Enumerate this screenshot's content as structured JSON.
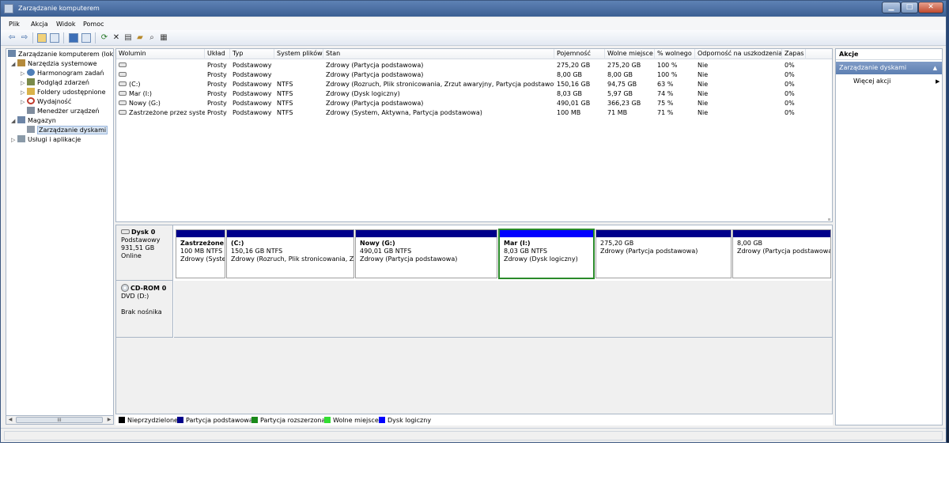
{
  "window": {
    "title": "Zarządzanie komputerem"
  },
  "menu": [
    "Plik",
    "Akcja",
    "Widok",
    "Pomoc"
  ],
  "tree": {
    "items": [
      {
        "label": "Zarządzanie komputerem (loka",
        "level": 0,
        "expander": "",
        "icon": "computer-icon",
        "color": "#6b86a8"
      },
      {
        "label": "Narzędzia systemowe",
        "level": 1,
        "expander": "◢",
        "icon": "tools-icon",
        "color": "#b48a3c"
      },
      {
        "label": "Harmonogram zadań",
        "level": 2,
        "expander": "▷",
        "icon": "clock-icon",
        "color": "#4f7fb8"
      },
      {
        "label": "Podgląd zdarzeń",
        "level": 2,
        "expander": "▷",
        "icon": "event-viewer-icon",
        "color": "#7a8a4a"
      },
      {
        "label": "Foldery udostępnione",
        "level": 2,
        "expander": "▷",
        "icon": "shared-folder-icon",
        "color": "#d9b24a"
      },
      {
        "label": "Wydajność",
        "level": 2,
        "expander": "▷",
        "icon": "performance-icon",
        "color": "#c0392b"
      },
      {
        "label": "Menedżer urządzeń",
        "level": 2,
        "expander": "",
        "icon": "device-manager-icon",
        "color": "#7f8c9d"
      },
      {
        "label": "Magazyn",
        "level": 1,
        "expander": "◢",
        "icon": "storage-icon",
        "color": "#6d85a6"
      },
      {
        "label": "Zarządzanie dyskami",
        "level": 2,
        "expander": "",
        "icon": "disk-management-icon",
        "color": "#8e99a6",
        "selected": true
      },
      {
        "label": "Usługi i aplikacje",
        "level": 1,
        "expander": "▷",
        "icon": "services-icon",
        "color": "#8a9aa8"
      }
    ],
    "scroll_glyph": "III"
  },
  "volumes": {
    "headers": [
      "Wolumin",
      "Układ",
      "Typ",
      "System plików",
      "Stan",
      "Pojemność",
      "Wolne miejsce",
      "% wolnego",
      "Odporność na uszkodzenia",
      "Zapas"
    ],
    "rows": [
      [
        "",
        "Prosty",
        "Podstawowy",
        "",
        "Zdrowy (Partycja podstawowa)",
        "275,20 GB",
        "275,20 GB",
        "100 %",
        "Nie",
        "0%"
      ],
      [
        "",
        "Prosty",
        "Podstawowy",
        "",
        "Zdrowy (Partycja podstawowa)",
        "8,00 GB",
        "8,00 GB",
        "100 %",
        "Nie",
        "0%"
      ],
      [
        "(C:)",
        "Prosty",
        "Podstawowy",
        "NTFS",
        "Zdrowy (Rozruch, Plik stronicowania, Zrzut awaryjny, Partycja podstawowa)",
        "150,16 GB",
        "94,75 GB",
        "63 %",
        "Nie",
        "0%"
      ],
      [
        "Mar (I:)",
        "Prosty",
        "Podstawowy",
        "NTFS",
        "Zdrowy (Dysk logiczny)",
        "8,03 GB",
        "5,97 GB",
        "74 %",
        "Nie",
        "0%"
      ],
      [
        "Nowy (G:)",
        "Prosty",
        "Podstawowy",
        "NTFS",
        "Zdrowy (Partycja podstawowa)",
        "490,01 GB",
        "366,23 GB",
        "75 %",
        "Nie",
        "0%"
      ],
      [
        "Zastrzeżone przez system",
        "Prosty",
        "Podstawowy",
        "NTFS",
        "Zdrowy (System, Aktywna, Partycja podstawowa)",
        "100 MB",
        "71 MB",
        "71 %",
        "Nie",
        "0%"
      ]
    ]
  },
  "disk0": {
    "name": "Dysk 0",
    "type": "Podstawowy",
    "size": "931,51 GB",
    "status": "Online",
    "partitions": [
      {
        "name": "Zastrzeżone p",
        "size": "100 MB NTFS",
        "status": "Zdrowy (Syste",
        "kind": "primary"
      },
      {
        "name": "(C:)",
        "size": "150,16 GB NTFS",
        "status": "Zdrowy (Rozruch, Plik stronicowania, Zrz",
        "kind": "primary"
      },
      {
        "name": "Nowy  (G:)",
        "size": "490,01 GB NTFS",
        "status": "Zdrowy (Partycja podstawowa)",
        "kind": "primary"
      },
      {
        "name": "Mar  (I:)",
        "size": "8,03 GB NTFS",
        "status": "Zdrowy (Dysk logiczny)",
        "kind": "logical",
        "selected": true
      },
      {
        "name": "",
        "size": "275,20 GB",
        "status": "Zdrowy (Partycja podstawowa)",
        "kind": "primary"
      },
      {
        "name": "",
        "size": "8,00 GB",
        "status": "Zdrowy (Partycja podstawowa)",
        "kind": "primary"
      }
    ]
  },
  "cdrom0": {
    "name": "CD-ROM 0",
    "drive": "DVD (D:)",
    "status": "Brak nośnika"
  },
  "legend": [
    {
      "label": "Nieprzydzielone",
      "color": "#000000"
    },
    {
      "label": "Partycja podstawowa",
      "color": "#00008b"
    },
    {
      "label": "Partycja rozszerzona",
      "color": "#1a8a1a"
    },
    {
      "label": "Wolne miejsce",
      "color": "#33dd33"
    },
    {
      "label": "Dysk logiczny",
      "color": "#0000ff"
    }
  ],
  "actions": {
    "title": "Akcje",
    "section": "Zarządzanie dyskami",
    "more": "Więcej akcji"
  }
}
